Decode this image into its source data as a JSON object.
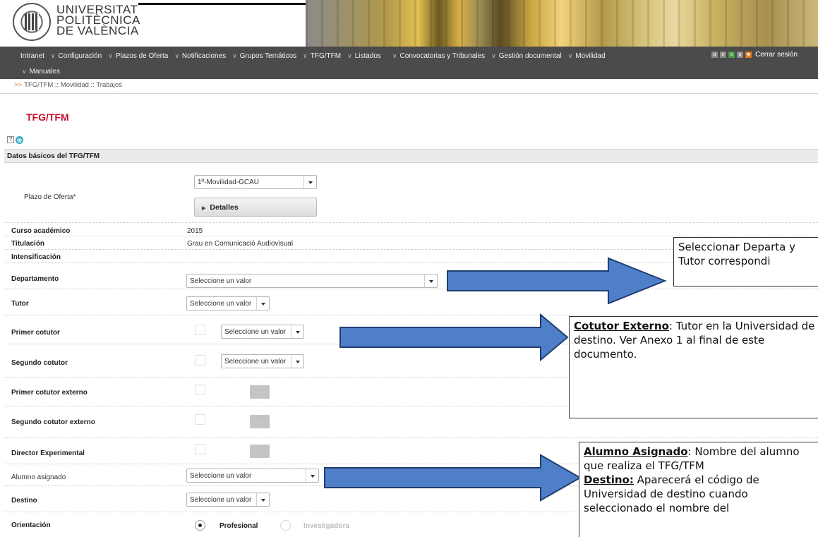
{
  "brand": {
    "line1": "UNIVERSITAT",
    "line2": "POLITÈCNICA",
    "line3": "DE VALÈNCIA"
  },
  "nav": {
    "row1": [
      "Intranet",
      "Configuración",
      "Plazos de Oferta",
      "Notificaciones",
      "Grupos Temáticos",
      "TFG/TFM",
      "Listados",
      "Convocatorias y Tribunales",
      "Gestión documental",
      "Movilidad"
    ],
    "row2": [
      "Manuales"
    ],
    "tools": [
      "gray-icon",
      "gray-icon",
      "green-icon",
      "gray-icon",
      "lock-icon"
    ],
    "logout": "Cerrar sesión"
  },
  "breadcrumb": "TFG/TFM :: Movilidad :: Trabajos",
  "page_title": "TFG/TFM",
  "section_title": "Datos básicos del TFG/TFM",
  "form": {
    "plazo_label": "Plazo de Oferta*",
    "plazo_value": "1º-Movilidad-GCAU",
    "details_label": "Detalles",
    "curso_label": "Curso académico",
    "curso_value": "2015",
    "titulacion_label": "Titulación",
    "titulacion_value": "Grau en Comunicació Audiovisual",
    "intensificacion_label": "Intensificación",
    "departamento_label": "Departamento",
    "departamento_value": "Seleccione un valor",
    "tutor_label": "Tutor",
    "tutor_value": "Seleccione un valor",
    "primer_cotutor_label": "Primer cotutor",
    "primer_cotutor_value": "Seleccione un valor",
    "segundo_cotutor_label": "Segundo cotutor",
    "segundo_cotutor_value": "Seleccione un valor",
    "primer_ext_label": "Primer cotutor externo",
    "segundo_ext_label": "Segundo cotutor externo",
    "director_label": "Director Experimental",
    "ellipsis": "...",
    "alumno_label": "Alumno asignado",
    "alumno_value": "Seleccione un valor",
    "destino_label": "Destino",
    "destino_value": "Seleccione un valor",
    "orientacion_label": "Orientación",
    "orient_opt1": "Profesional",
    "orient_opt2": "Investigadora",
    "orient_selected": "Profesional"
  },
  "callouts": {
    "c1_text": "Seleccionar Departa y Tutor correspondi",
    "c2_title": "Cotutor Externo",
    "c2_text": ": Tutor en la Universidad de destino.  Ver Anexo 1 al final de este documento.",
    "c3_title1": "Alumno Asignado",
    "c3_text1": ": Nombre del alumno que realiza el TFG/TFM",
    "c3_title2": "Destino:",
    "c3_text2": " Aparecerá el código de Universidad de destino cuando seleccionado el nombre del"
  },
  "colors": {
    "nav_bg": "#4b4b4b",
    "title_red": "#c8102e",
    "arrow_fill": "#4f7fc8",
    "arrow_stroke": "#1f3d73"
  }
}
